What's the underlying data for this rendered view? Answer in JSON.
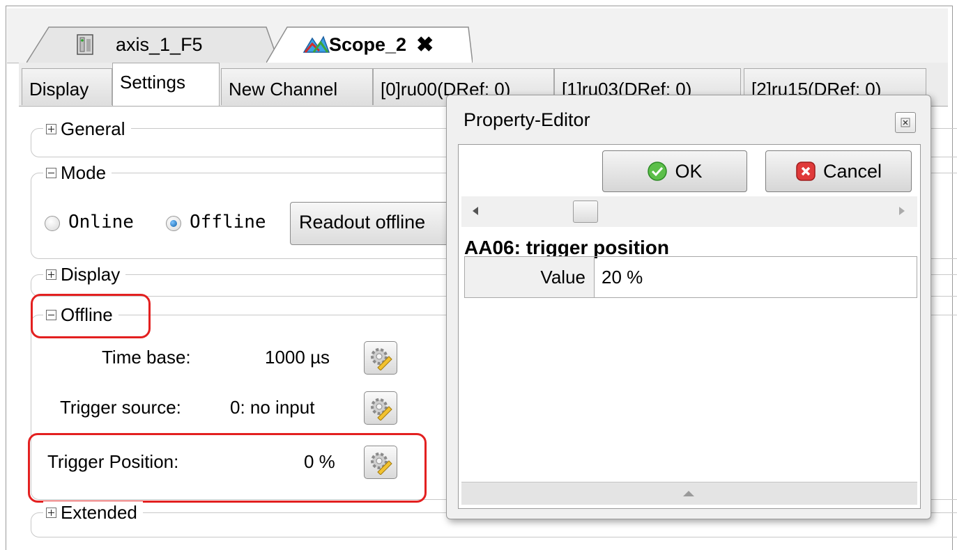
{
  "doc_tabs": [
    {
      "label": "axis_1_F5",
      "icon": "server-icon"
    },
    {
      "label": "Scope_2",
      "icon": "scope-icon",
      "close": "✖"
    }
  ],
  "sub_tabs": [
    "Display",
    "Settings",
    "New Channel",
    "[0]ru00(DRef: 0)",
    "[1]ru03(DRef: 0)",
    "[2]ru15(DRef: 0)"
  ],
  "active_sub_tab": "Settings",
  "groups": {
    "general": "General",
    "mode": "Mode",
    "display": "Display",
    "offline": "Offline",
    "extended": "Extended"
  },
  "mode": {
    "online_label": "Online",
    "offline_label": "Offline",
    "selected": "Offline",
    "readout_button": "Readout offline"
  },
  "offline": {
    "time_base_label": "Time base:",
    "time_base_value": "1000 µs",
    "trigger_source_label": "Trigger source:",
    "trigger_source_value": "0: no input",
    "trigger_position_label": "Trigger Position:",
    "trigger_position_value": "0 %"
  },
  "dialog": {
    "title": "Property-Editor",
    "ok_label": "OK",
    "cancel_label": "Cancel",
    "property_title": "AA06: trigger position",
    "value_key": "Value",
    "value": "20 %"
  },
  "colors": {
    "highlight": "#e32020",
    "ok_green": "#3aa53a",
    "cancel_red": "#d92b2b"
  }
}
